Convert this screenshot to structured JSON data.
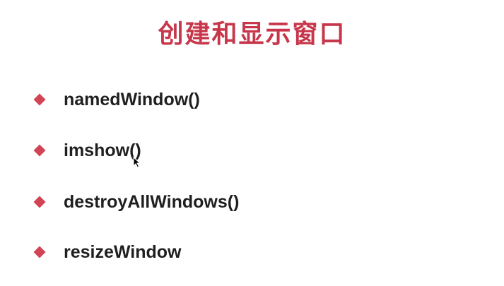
{
  "slide": {
    "title": "创建和显示窗口",
    "bullets": [
      {
        "text": "namedWindow()"
      },
      {
        "text": "imshow()"
      },
      {
        "text": "destroyAllWindows()"
      },
      {
        "text": "resizeWindow"
      }
    ],
    "colors": {
      "title": "#c7364a",
      "bullet_marker": "#d14455",
      "text": "#1f1f1f",
      "background": "#ffffff"
    },
    "icons": {
      "bullet_marker": "diamond-icon",
      "cursor": "mouse-pointer-icon"
    }
  }
}
